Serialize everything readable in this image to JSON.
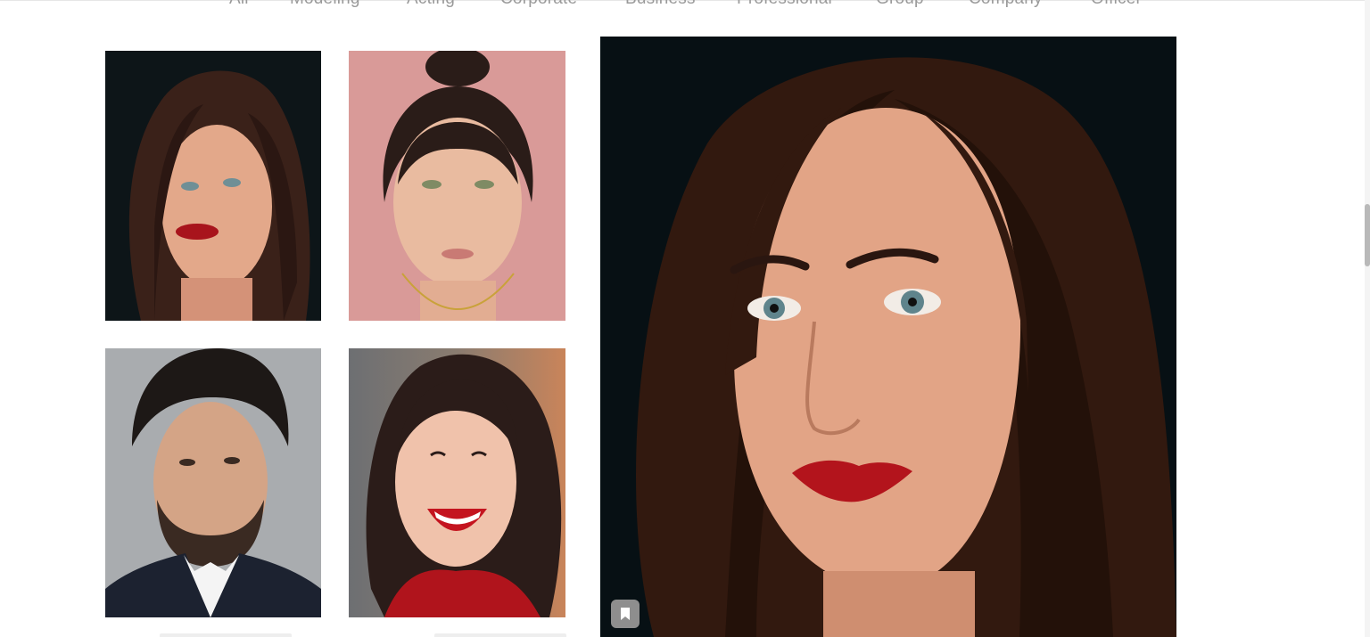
{
  "filters": {
    "items": [
      {
        "label": "All"
      },
      {
        "label": "Modeling"
      },
      {
        "label": "Acting"
      },
      {
        "label": "Corporate"
      },
      {
        "label": "Business"
      },
      {
        "label": "Professional"
      },
      {
        "label": "Group"
      },
      {
        "label": "Company"
      },
      {
        "label": "Officer"
      }
    ]
  },
  "gallery": {
    "thumbnails": [
      {
        "subject": "woman-dark-hair-red-lips",
        "background": "#0d1518"
      },
      {
        "subject": "woman-bun-pink-background",
        "background": "#d99a98"
      },
      {
        "subject": "man-beard-suit",
        "background": "#a9acaf"
      },
      {
        "subject": "woman-smiling-red-top",
        "background": "#6e6a68"
      }
    ],
    "preview": {
      "subject": "woman-dark-hair-red-lips-closeup",
      "background": "#071014"
    },
    "bookmark_icon": "bookmark-icon"
  },
  "colors": {
    "filter_text": "#9a9a9a",
    "bookmark_button": "#8e8e8e",
    "lipstick": "#b3141c"
  }
}
